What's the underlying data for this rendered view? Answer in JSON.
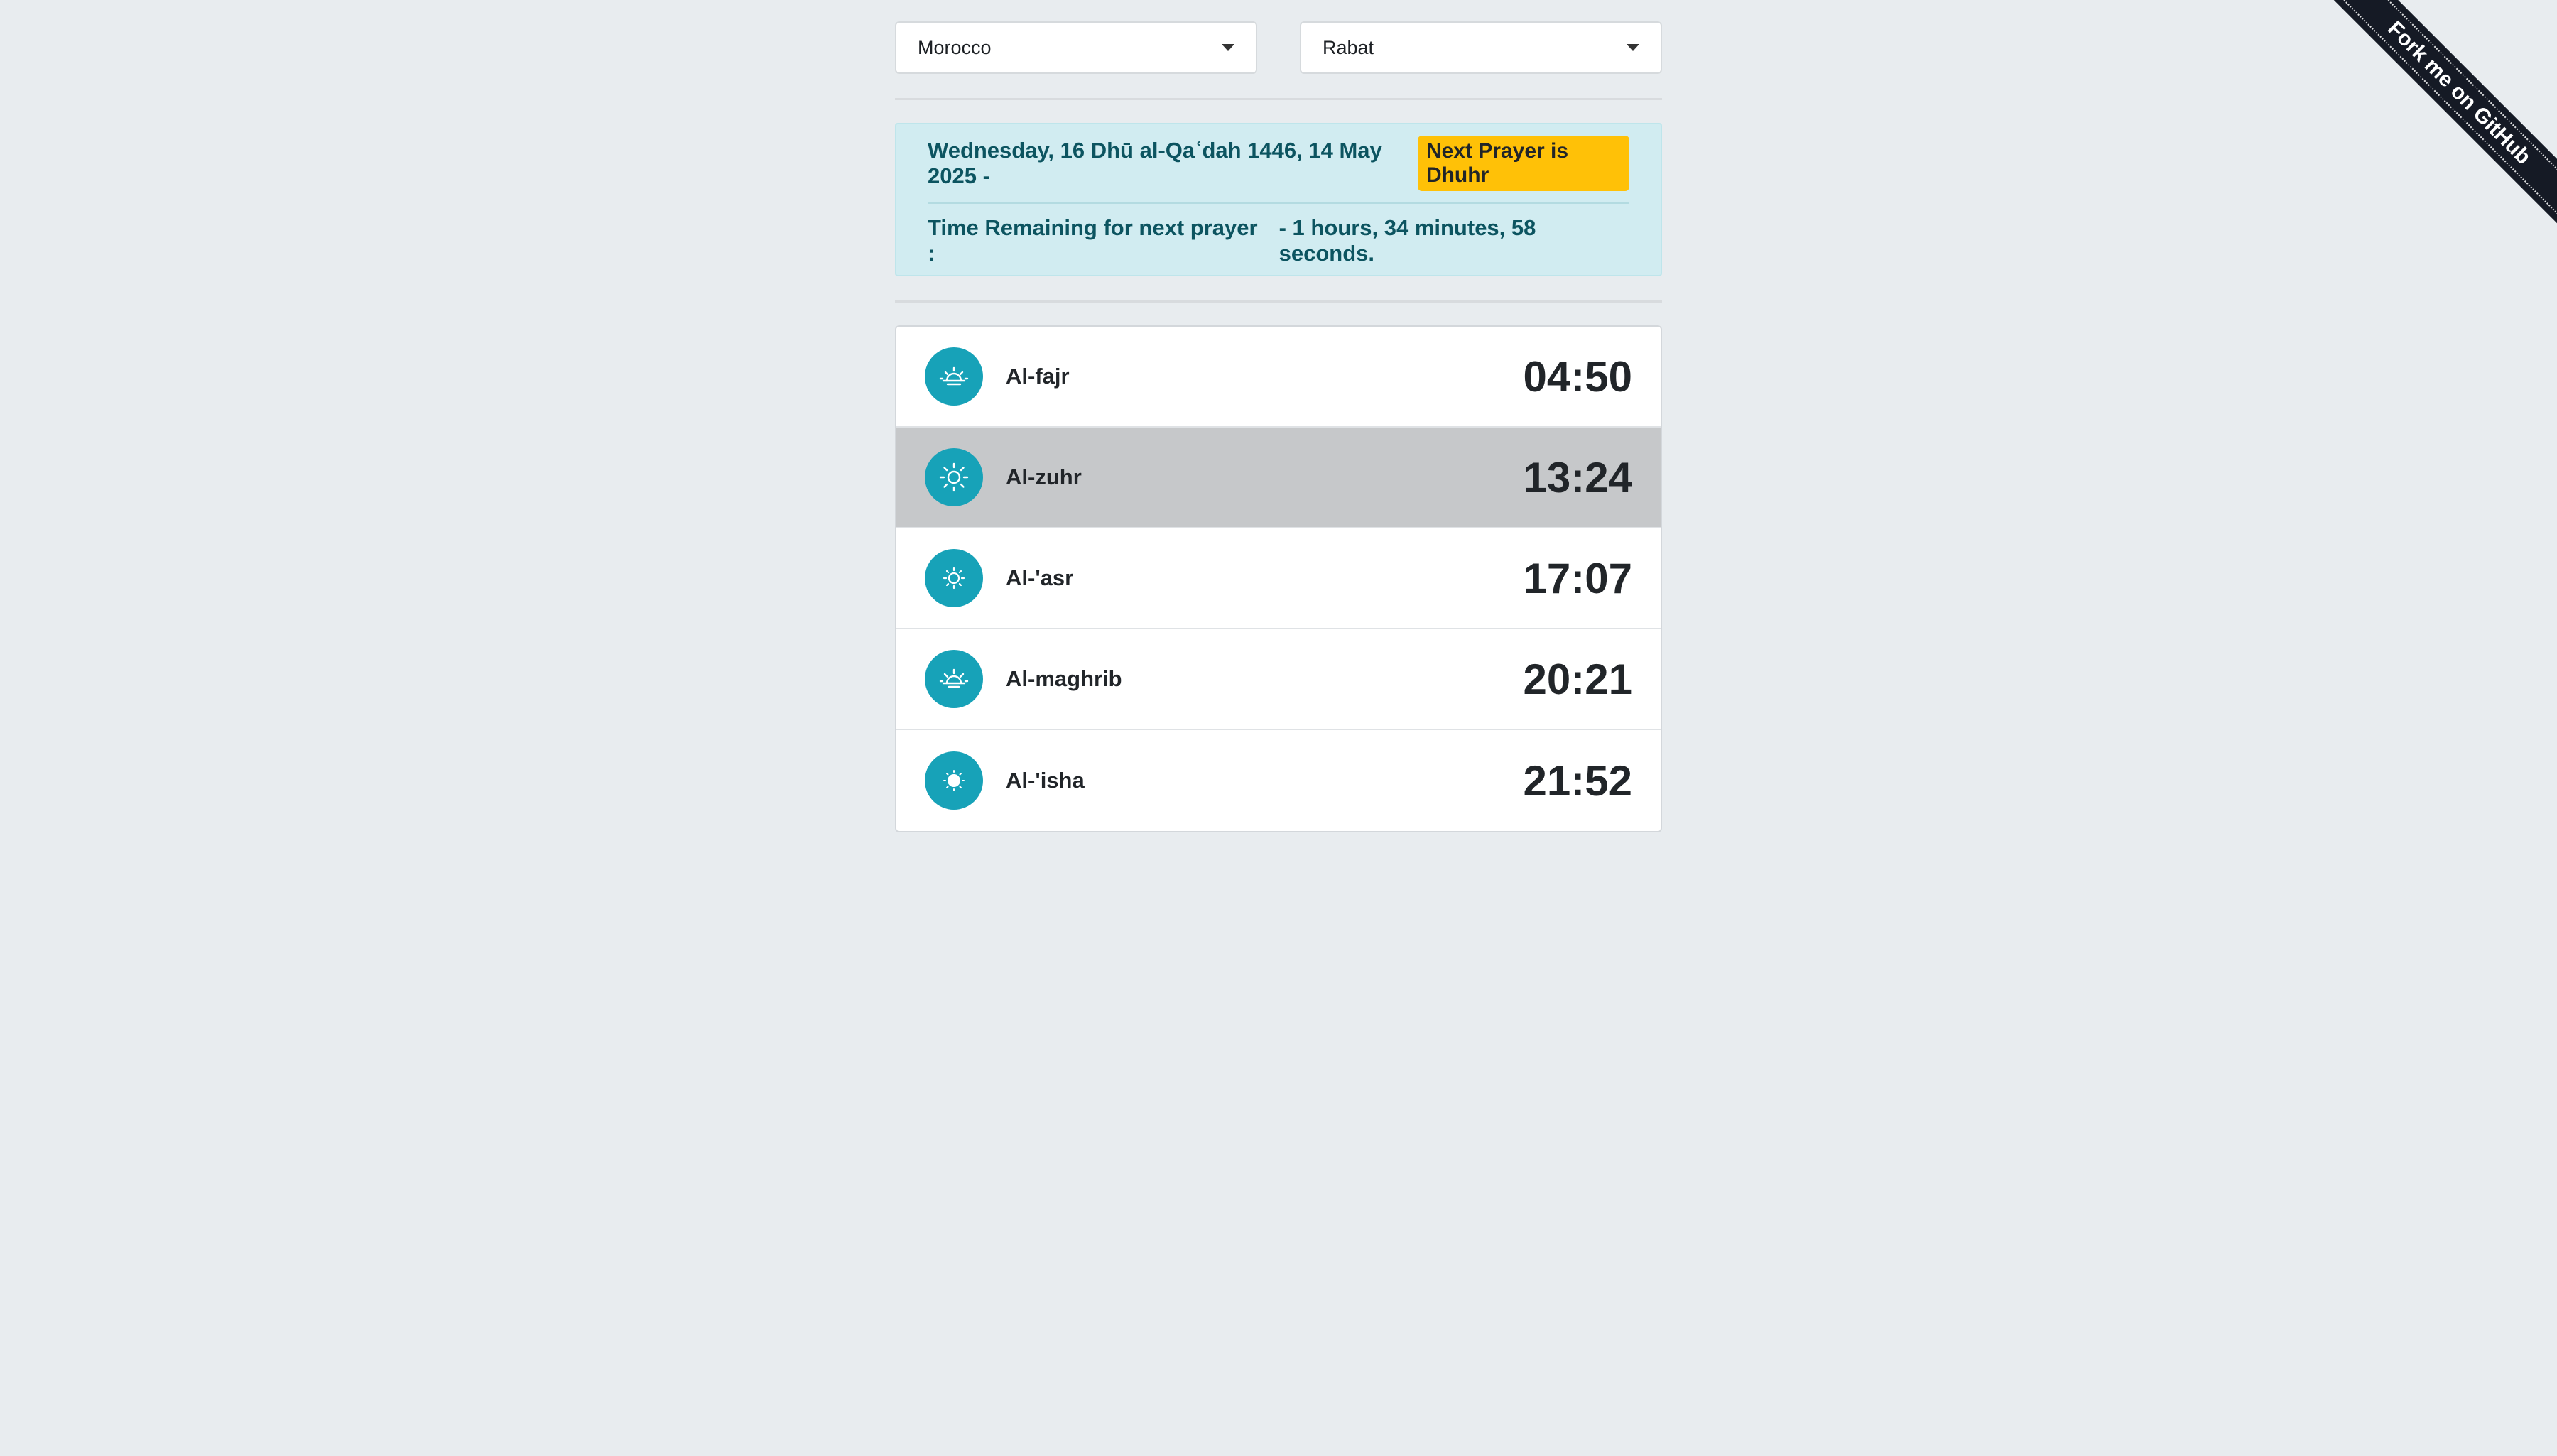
{
  "country_select": {
    "value": "Morocco"
  },
  "city_select": {
    "value": "Rabat"
  },
  "info": {
    "date": "Wednesday, 16 Dhū al-Qaʿdah 1446, 14 May 2025 -",
    "next_prayer_badge": "Next Prayer is Dhuhr",
    "remaining_label": "Time Remaining for next prayer :",
    "remaining_value": "- 1 hours, 34 minutes, 58 seconds."
  },
  "prayers": [
    {
      "name": "Al-fajr",
      "time": "04:50",
      "icon": "sunrise-icon"
    },
    {
      "name": "Al-zuhr",
      "time": "13:24",
      "icon": "sun-icon"
    },
    {
      "name": "Al-'asr",
      "time": "17:07",
      "icon": "sun-small-icon"
    },
    {
      "name": "Al-maghrib",
      "time": "20:21",
      "icon": "sunset-icon"
    },
    {
      "name": "Al-'isha",
      "time": "21:52",
      "icon": "moon-sun-icon"
    }
  ],
  "ribbon": {
    "label": "Fork me on GitHub"
  },
  "colors": {
    "accent": "#17a2b8",
    "badge": "#ffc107",
    "alert_bg": "#d1ecf1",
    "active_row": "#c6c8ca"
  }
}
